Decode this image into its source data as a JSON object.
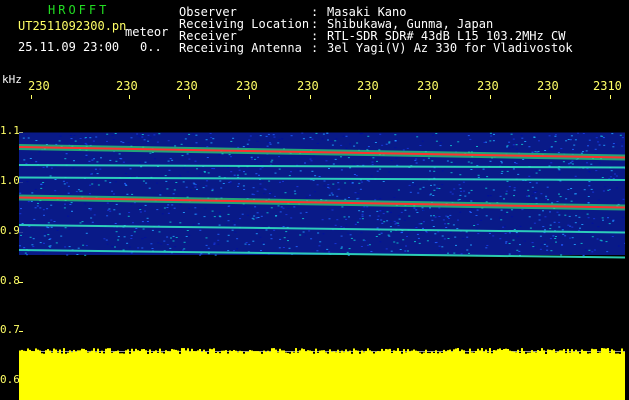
{
  "header": {
    "app_name": "HROFFT",
    "file_name": "UT2511092300.pn",
    "file_type": "meteor",
    "datetime": "25.11.09 23:00",
    "dots": "0..",
    "info": [
      {
        "label": "Observer",
        "value": "Masaki Kano"
      },
      {
        "label": "Receiving Location",
        "value": "Shibukawa, Gunma, Japan"
      },
      {
        "label": "Receiver",
        "value": "RTL-SDR SDR# 43dB L15 103.2MHz CW"
      },
      {
        "label": "Receiving Antenna",
        "value": "3el Yagi(V) Az 330 for Vladivostok"
      }
    ]
  },
  "axis": {
    "unit": "kHz",
    "x_ticks": [
      "230",
      "230",
      "230",
      "230",
      "230",
      "230",
      "230",
      "230",
      "230",
      "2310"
    ],
    "y_ticks": [
      "1.1",
      "1.0",
      "0.9",
      "0.8",
      "0.7",
      "0.6"
    ]
  },
  "spectrogram": {
    "freq_range": [
      0.6,
      1.1
    ],
    "noise_band": [
      0.79,
      1.035
    ],
    "signal_lines": [
      {
        "f_start": 1.006,
        "f_end": 0.985,
        "strength": "strong"
      },
      {
        "f_start": 0.905,
        "f_end": 0.885,
        "strength": "strong"
      },
      {
        "f_start": 0.97,
        "f_end": 0.965,
        "strength": "weak"
      },
      {
        "f_start": 0.945,
        "f_end": 0.94,
        "strength": "weak"
      },
      {
        "f_start": 0.85,
        "f_end": 0.835,
        "strength": "weak"
      },
      {
        "f_start": 0.8,
        "f_end": 0.785,
        "strength": "weak"
      }
    ],
    "colors": {
      "background": "#000000",
      "noise": "#0a1ea0",
      "signal_strong": "#ff3030",
      "signal_weak": "#30e0c0",
      "level_bar": "#ffff00",
      "tick": "#ffff66"
    }
  }
}
